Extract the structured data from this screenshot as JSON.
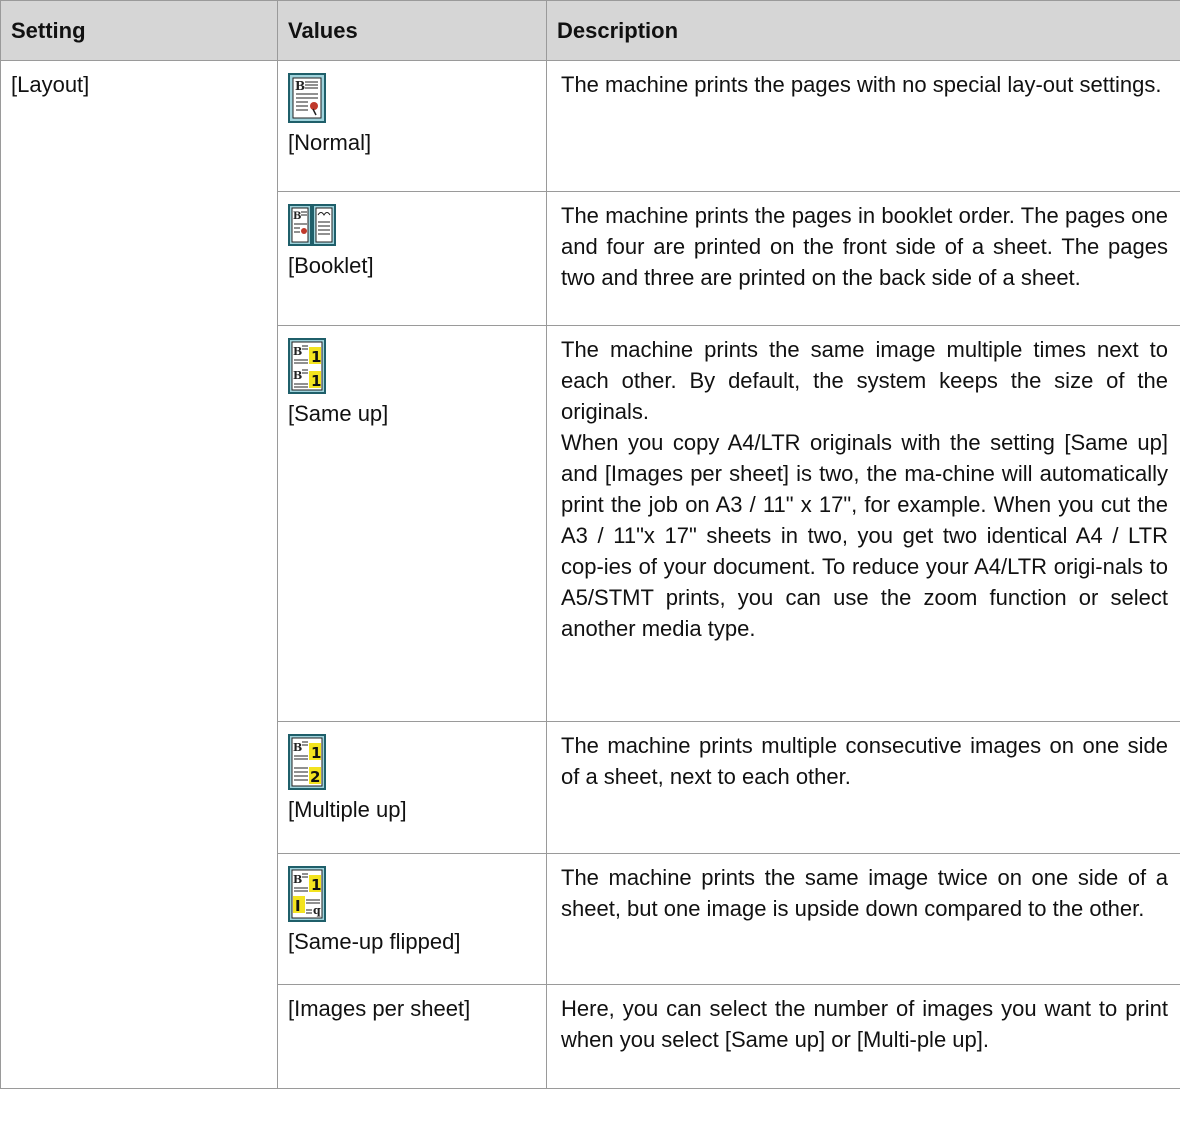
{
  "headers": {
    "setting": "Setting",
    "values": "Values",
    "description": "Description"
  },
  "setting_name": "[Layout]",
  "rows": [
    {
      "icon": "normal-layout-icon",
      "value": "[Normal]",
      "description": [
        "The machine prints the pages with no special lay-out settings."
      ]
    },
    {
      "icon": "booklet-layout-icon",
      "value": "[Booklet]",
      "description": [
        "The machine prints the pages in booklet order. The pages one and four are printed on the front side of a sheet. The pages two and three are printed on the back side of a sheet."
      ]
    },
    {
      "icon": "same-up-layout-icon",
      "value": "[Same up]",
      "description": [
        "The machine prints the same image multiple times next to each other. By default, the system keeps the size of the originals.",
        "When you copy A4/LTR originals with the setting [Same up] and [Images per sheet] is two, the ma-chine will automatically print the job on A3 / 11\" x 17\", for example. When you cut the A3 / 11\"x 17\" sheets in two, you get two identical A4 / LTR cop-ies of your document. To reduce your A4/LTR origi-nals to A5/STMT prints, you can use the zoom function or select another media type."
      ]
    },
    {
      "icon": "multiple-up-layout-icon",
      "value": "[Multiple up]",
      "description": [
        "The machine prints multiple consecutive images on one side of a sheet, next to each other."
      ]
    },
    {
      "icon": "same-up-flipped-layout-icon",
      "value": "[Same-up flipped]",
      "description": [
        "The machine prints the same image twice on one side of a sheet, but one image is upside down compared to the other."
      ]
    },
    {
      "icon": "",
      "value": "[Images per sheet]",
      "description": [
        "Here, you can select the number of images you want to print when you select [Same up] or [Multi-ple up]."
      ]
    }
  ]
}
